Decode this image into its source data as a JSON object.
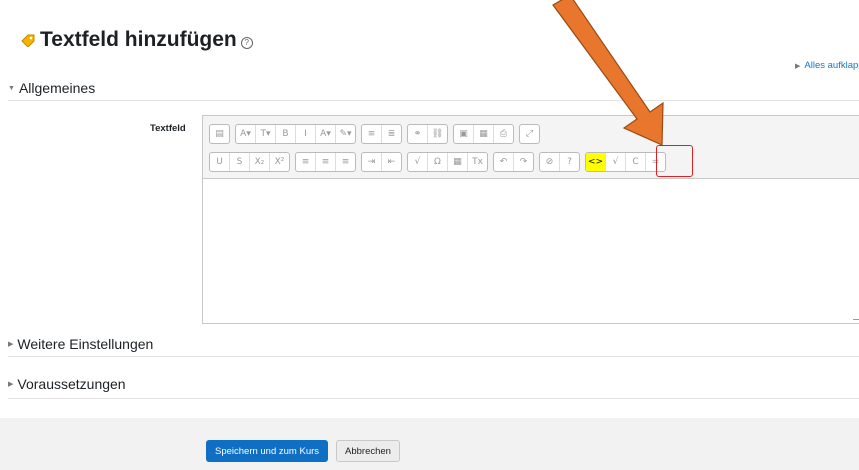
{
  "page": {
    "title": "Textfeld hinzufügen",
    "help_symbol": "?",
    "expand_all": "Alles aufklappen",
    "sections": {
      "general": "Allgemeines",
      "more_settings": "Weitere Einstellungen",
      "prerequisites": "Voraussetzungen"
    },
    "field_label": "Textfeld",
    "save_button": "Speichern und zum Kurs",
    "cancel_button": "Abbrechen"
  },
  "toolbar": {
    "row1": [
      [
        "▤"
      ],
      [
        "A▾",
        "T▾",
        "B",
        "I",
        "A▾",
        "✎▾"
      ],
      [
        "≡",
        "≣"
      ],
      [
        "⚭",
        "⛓"
      ],
      [
        "▣",
        "▦",
        "⎙"
      ],
      [
        "⤢"
      ]
    ],
    "row2": [
      [
        "U",
        "S",
        "X₂",
        "X²"
      ],
      [
        "≡",
        "≡",
        "≡"
      ],
      [
        "⇥",
        "⇤"
      ],
      [
        "√",
        "Ω",
        "▦",
        "Tx"
      ],
      [
        "↶",
        "↷"
      ],
      [
        "⊘",
        "?"
      ],
      [
        "<>",
        "√",
        "C",
        "="
      ]
    ],
    "highlighted": "html-source-button"
  },
  "annotation": {
    "arrow_color": "#e8762c",
    "highlight_color": "#ffff00",
    "box_color": "#e02020"
  }
}
